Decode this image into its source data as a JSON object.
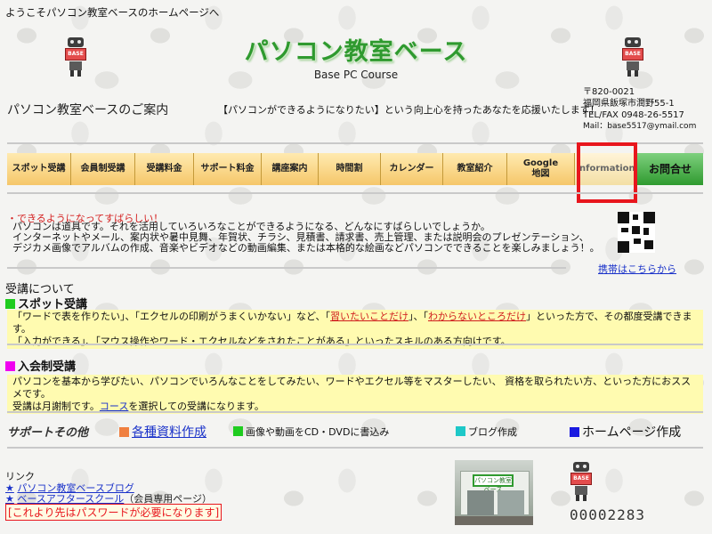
{
  "header": {
    "welcome": "ようこそパソコン教室ベースのホームページへ",
    "site_title": "パソコン教室ベース",
    "site_subtitle": "Base PC Course",
    "intro": "パソコン教室ベースのご案内",
    "tagline": "【パソコンができるようになりたい】という向上心を持ったあなたを応援いたします！",
    "logo_text": "BASE"
  },
  "contact": {
    "zip": "〒820-0021",
    "address": "福岡県飯塚市潤野55-1",
    "tel": "TEL/FAX 0948-26-5517",
    "mail": "Mail：base5517@ymail.com"
  },
  "nav": {
    "items": [
      {
        "label": "スポット受講"
      },
      {
        "label": "会員制受講"
      },
      {
        "label": "受講料金"
      },
      {
        "label": "サポート料金"
      },
      {
        "label": "講座案内"
      },
      {
        "label": "時間割"
      },
      {
        "label": "カレンダー"
      },
      {
        "label": "教室紹介"
      },
      {
        "label": "Google\n地図"
      },
      {
        "label": "Information"
      },
      {
        "label": "お問合せ"
      }
    ]
  },
  "message": {
    "headline": "・できるようになってすばらしい！",
    "line1": "パソコンは道具です。それを活用していろいろなことができるようになる、どんなにすばらしいでしょうか。",
    "line2": "インターネットやメール、案内状や暑中見舞、年賀状、チラシ、見積書、請求書、売上管理、または説明会のプレゼンテーション、",
    "line3": "デジカメ画像でアルバムの作成、音楽やビデオなどの動画編集、または本格的な絵画などパソコンでできることを楽しみましょう！。",
    "mobile_link": "携帯はこちらから"
  },
  "courses": {
    "heading": "受講について",
    "spot": {
      "title": "スポット受講",
      "l1a": "「ワードで表を作りたい」、「エクセルの印刷がうまくいかない」など、「",
      "l1b": "習いたいことだけ",
      "l1c": "」、「",
      "l1d": "わからないところだけ",
      "l1e": "」といった方で、その都度受講できます。",
      "l2": "「入力ができる」、「マウス操作やワード・エクセルなどをされたことがある」といったスキルのある方向けです。"
    },
    "member": {
      "title": "入会制受講",
      "l1": "パソコンを基本から学びたい、パソコンでいろんなことをしてみたい、ワードやエクセル等をマスターしたい、 資格を取られたい方、といった方におススメです。",
      "l2a": "受講は月謝制です。",
      "l2b": "コース",
      "l2c": "を選択しての受講になります。"
    }
  },
  "support": {
    "label": "サポートその他",
    "items": [
      {
        "label": "各種資料作成"
      },
      {
        "label": "画像や動画をCD・DVDに書込み"
      },
      {
        "label": "ブログ作成"
      },
      {
        "label": "ホームページ作成"
      }
    ]
  },
  "links": {
    "title": "リンク",
    "items": [
      {
        "label": "パソコン教室ベースブログ",
        "note": ""
      },
      {
        "label": "ベースアフタースクール",
        "note": "（会員専用ページ）"
      }
    ],
    "star": "★",
    "warning": "[これより先はパスワードが必要になります]",
    "photo_sign": "パソコン教室\nベース"
  },
  "counter": "00002283",
  "colors": {
    "green": "#2f9a2f",
    "red": "#e8161d",
    "link": "#1a32c9",
    "yellow_box": "#fffbb0",
    "orange_bullet": "#f08040",
    "magenta_bullet": "#f000f0",
    "green_bullet": "#1fcc1f",
    "cyan_bullet": "#1ec8c8",
    "blue_bullet": "#1a1ae0"
  }
}
